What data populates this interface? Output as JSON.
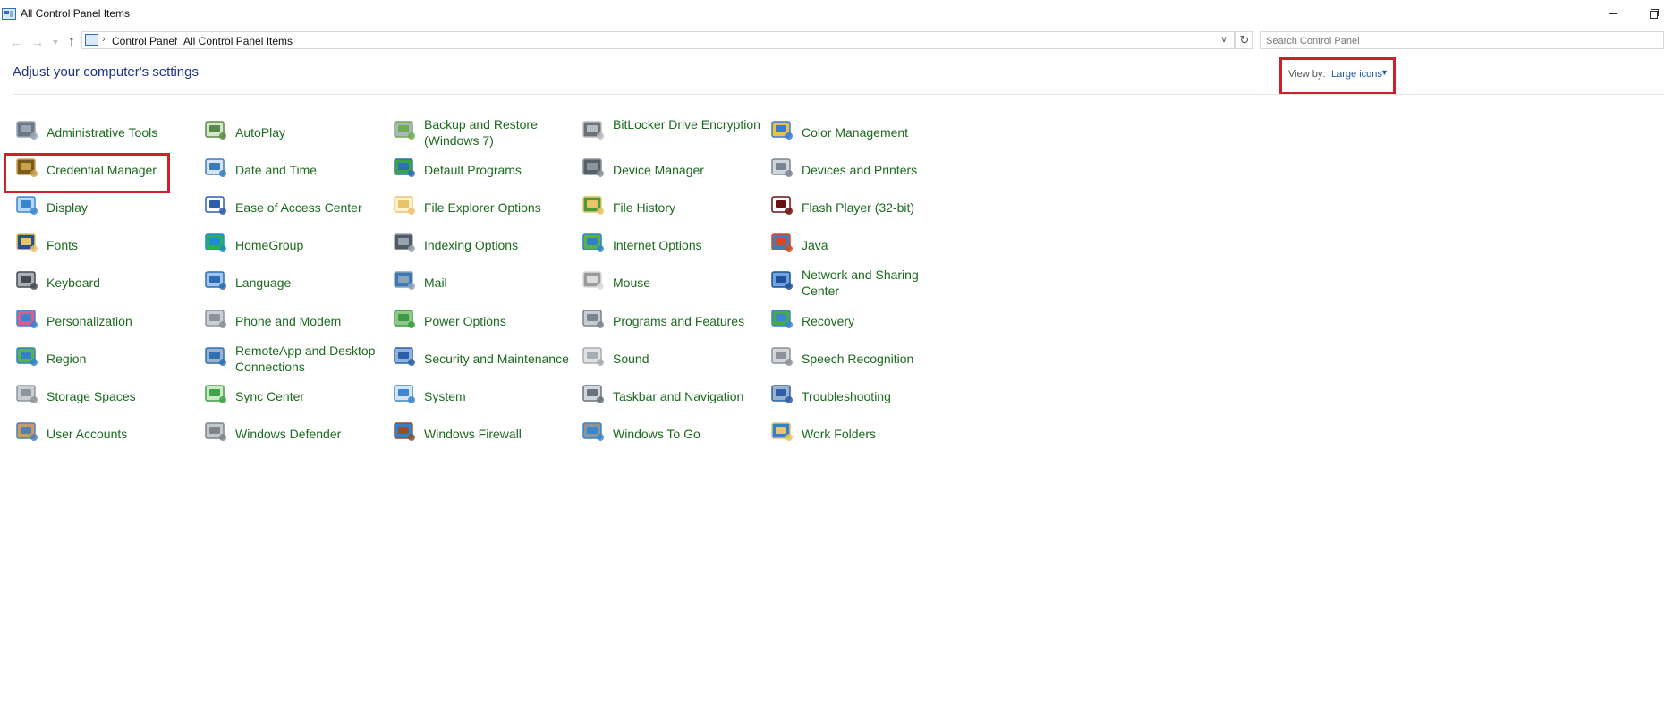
{
  "window": {
    "title": "All Control Panel Items"
  },
  "address": {
    "crumbs": [
      "Control Panel",
      "All Control Panel Items"
    ],
    "search_placeholder": "Search Control Panel"
  },
  "header": {
    "title": "Adjust your computer's settings",
    "view_by_label": "View by:",
    "view_by_value": "Large icons"
  },
  "items": [
    {
      "label": "Administrative Tools",
      "icon": "administrative-tools-icon"
    },
    {
      "label": "AutoPlay",
      "icon": "autoplay-icon"
    },
    {
      "label": "Backup and Restore (Windows 7)",
      "icon": "backup-restore-icon"
    },
    {
      "label": "BitLocker Drive Encryption",
      "icon": "bitlocker-icon"
    },
    {
      "label": "Color Management",
      "icon": "color-management-icon"
    },
    {
      "label": "Credential Manager",
      "icon": "credential-manager-icon"
    },
    {
      "label": "Date and Time",
      "icon": "date-time-icon"
    },
    {
      "label": "Default Programs",
      "icon": "default-programs-icon"
    },
    {
      "label": "Device Manager",
      "icon": "device-manager-icon"
    },
    {
      "label": "Devices and Printers",
      "icon": "devices-printers-icon"
    },
    {
      "label": "Display",
      "icon": "display-icon"
    },
    {
      "label": "Ease of Access Center",
      "icon": "ease-of-access-icon"
    },
    {
      "label": "File Explorer Options",
      "icon": "file-explorer-options-icon"
    },
    {
      "label": "File History",
      "icon": "file-history-icon"
    },
    {
      "label": "Flash Player (32-bit)",
      "icon": "flash-player-icon"
    },
    {
      "label": "Fonts",
      "icon": "fonts-icon"
    },
    {
      "label": "HomeGroup",
      "icon": "homegroup-icon"
    },
    {
      "label": "Indexing Options",
      "icon": "indexing-options-icon"
    },
    {
      "label": "Internet Options",
      "icon": "internet-options-icon"
    },
    {
      "label": "Java",
      "icon": "java-icon"
    },
    {
      "label": "Keyboard",
      "icon": "keyboard-icon"
    },
    {
      "label": "Language",
      "icon": "language-icon"
    },
    {
      "label": "Mail",
      "icon": "mail-icon"
    },
    {
      "label": "Mouse",
      "icon": "mouse-icon"
    },
    {
      "label": "Network and Sharing Center",
      "icon": "network-sharing-icon"
    },
    {
      "label": "Personalization",
      "icon": "personalization-icon"
    },
    {
      "label": "Phone and Modem",
      "icon": "phone-modem-icon"
    },
    {
      "label": "Power Options",
      "icon": "power-options-icon"
    },
    {
      "label": "Programs and Features",
      "icon": "programs-features-icon"
    },
    {
      "label": "Recovery",
      "icon": "recovery-icon"
    },
    {
      "label": "Region",
      "icon": "region-icon"
    },
    {
      "label": "RemoteApp and Desktop Connections",
      "icon": "remoteapp-icon"
    },
    {
      "label": "Security and Maintenance",
      "icon": "security-maintenance-icon"
    },
    {
      "label": "Sound",
      "icon": "sound-icon"
    },
    {
      "label": "Speech Recognition",
      "icon": "speech-recognition-icon"
    },
    {
      "label": "Storage Spaces",
      "icon": "storage-spaces-icon"
    },
    {
      "label": "Sync Center",
      "icon": "sync-center-icon"
    },
    {
      "label": "System",
      "icon": "system-icon"
    },
    {
      "label": "Taskbar and Navigation",
      "icon": "taskbar-navigation-icon"
    },
    {
      "label": "Troubleshooting",
      "icon": "troubleshooting-icon"
    },
    {
      "label": "User Accounts",
      "icon": "user-accounts-icon"
    },
    {
      "label": "Windows Defender",
      "icon": "windows-defender-icon"
    },
    {
      "label": "Windows Firewall",
      "icon": "windows-firewall-icon"
    },
    {
      "label": "Windows To Go",
      "icon": "windows-to-go-icon"
    },
    {
      "label": "Work Folders",
      "icon": "work-folders-icon"
    }
  ],
  "colors": {
    "link": "#1b6a1d",
    "heading": "#1e3287",
    "highlight": "#d0202a"
  }
}
